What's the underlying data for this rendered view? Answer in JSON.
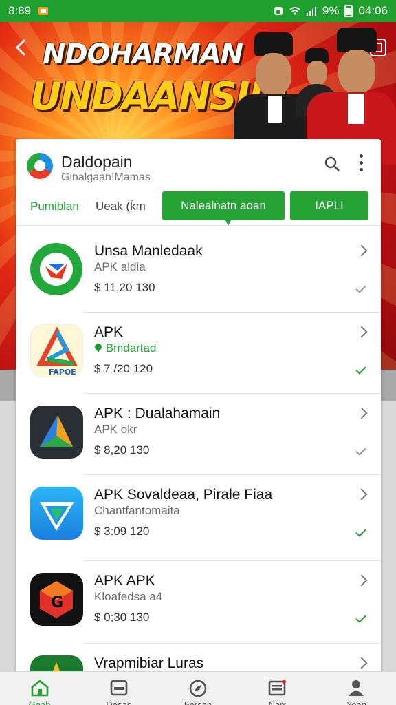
{
  "status_bar": {
    "time_left": "8:89",
    "battery_pct": "9%",
    "clock": "04:06"
  },
  "banner": {
    "title_line1": "NDOHARMAN",
    "title_line2": "UNDAANSIIA"
  },
  "app": {
    "name": "Daldopain",
    "subtitle": "Ginalgaan!Mamas",
    "tabs": [
      {
        "label": "Pumiblan"
      },
      {
        "label": "Ueak (ḱm"
      },
      {
        "label": "Nalealnatn aoan"
      },
      {
        "label": "IAPLI"
      }
    ]
  },
  "list": [
    {
      "name": "Unsa Manledaak",
      "sub": "APK aldia",
      "price": "$ 11,20 130",
      "check_color": "#999999"
    },
    {
      "name": "APK",
      "sub": "Bmdartad",
      "price": "$ 7 /20 120",
      "check_color": "#1e9f2e"
    },
    {
      "name": "APK : Dualahamain",
      "sub": "APK okr",
      "price": "$ 8,20 130",
      "check_color": "#999999"
    },
    {
      "name": "APK Sovaldeaa, Pirale Fiaa",
      "sub": "Chantfantomaita",
      "price": "$ 3:09 120",
      "check_color": "#1e9f2e"
    },
    {
      "name": "APK APK",
      "sub": "Kloafedsa a4",
      "price": "$ 0;30 130",
      "check_color": "#1e9f2e"
    },
    {
      "name": "Vrapmibiar Luras",
      "sub": "",
      "price": ""
    }
  ],
  "bottom_nav": [
    {
      "label": "Geah",
      "icon": "home-icon",
      "active": true
    },
    {
      "label": "Desas",
      "icon": "wallet-icon",
      "active": false
    },
    {
      "label": "Fersan",
      "icon": "compass-icon",
      "active": false
    },
    {
      "label": "Narr",
      "icon": "news-icon",
      "active": false
    },
    {
      "label": "Yoan",
      "icon": "profile-icon",
      "active": false
    }
  ],
  "colors": {
    "accent": "#1e9f2e",
    "banner_red": "#d8221a",
    "banner_gold": "#ffcc1a"
  }
}
